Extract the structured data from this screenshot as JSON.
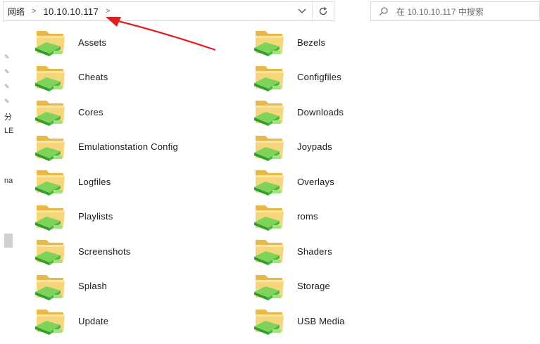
{
  "address_bar": {
    "breadcrumbs": [
      "网络",
      "10.10.10.117"
    ],
    "separator": ">"
  },
  "search": {
    "placeholder": "在 10.10.10.117 中搜索"
  },
  "nav_pane": {
    "snippets": [
      "分",
      "LE",
      "na"
    ]
  },
  "folders": [
    {
      "label": "Assets"
    },
    {
      "label": "Bezels"
    },
    {
      "label": "Cheats"
    },
    {
      "label": "Configfiles"
    },
    {
      "label": "Cores"
    },
    {
      "label": "Downloads"
    },
    {
      "label": "Emulationstation Config"
    },
    {
      "label": "Joypads"
    },
    {
      "label": "Logfiles"
    },
    {
      "label": "Overlays"
    },
    {
      "label": "Playlists"
    },
    {
      "label": "roms"
    },
    {
      "label": "Screenshots"
    },
    {
      "label": "Shaders"
    },
    {
      "label": "Splash"
    },
    {
      "label": "Storage"
    },
    {
      "label": "Update"
    },
    {
      "label": "USB Media"
    }
  ],
  "colors": {
    "annotation_arrow": "#e02020",
    "folder": "#f3cf6b",
    "share_badge": "#34b233"
  }
}
